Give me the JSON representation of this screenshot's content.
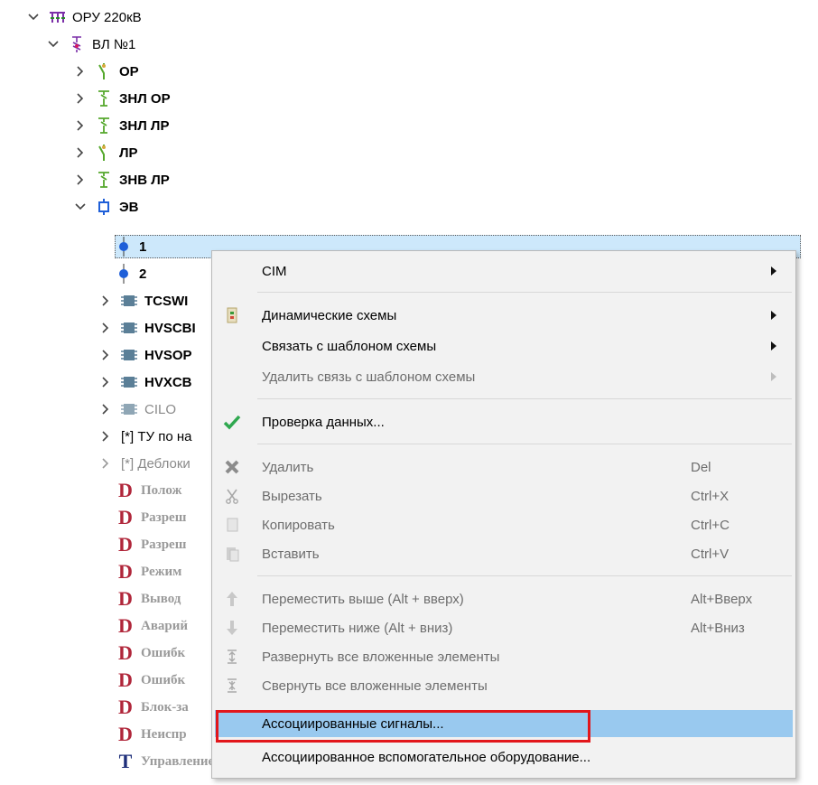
{
  "tree": {
    "root": "ОРУ 220кВ",
    "line": "ВЛ №1",
    "children": [
      "ОР",
      "ЗНЛ ОР",
      "ЗНЛ ЛР",
      "ЛР",
      "ЗНВ ЛР",
      "ЭВ"
    ],
    "ev_children": [
      "1",
      "2"
    ],
    "devices": [
      "TCSWI",
      "HVSCBI",
      "HVSOP",
      "HVXCB",
      "CILO"
    ],
    "groups": [
      "[*] ТУ по на",
      "[*] Деблоки"
    ],
    "d_items": [
      "Полож",
      "Разреш",
      "Разреш",
      "Режим",
      "Вывод",
      "Аварий",
      "Ошибк",
      "Ошибк",
      "Блок-за",
      "Неиспр"
    ],
    "t_item": "Управление",
    "colors": {
      "selection": "#cde8fb",
      "d_icon": "#b0263a",
      "t_icon": "#1e2f7a",
      "switch_green": "#55a82c",
      "ev_blue": "#1f5fd8"
    }
  },
  "menu": {
    "cim": "CIM",
    "dynamic": "Динамические схемы",
    "link_template": "Связать с шаблоном схемы",
    "unlink_template": "Удалить связь с шаблоном схемы",
    "check": "Проверка данных...",
    "delete": "Удалить",
    "delete_key": "Del",
    "cut": "Вырезать",
    "cut_key": "Ctrl+X",
    "copy": "Копировать",
    "copy_key": "Ctrl+C",
    "paste": "Вставить",
    "paste_key": "Ctrl+V",
    "move_up": "Переместить выше (Alt + вверх)",
    "move_up_key": "Alt+Вверх",
    "move_down": "Переместить ниже (Alt + вниз)",
    "move_down_key": "Alt+Вниз",
    "expand": "Развернуть все вложенные элементы",
    "collapse": "Свернуть все вложенные элементы",
    "assoc_signals": "Ассоциированные сигналы...",
    "assoc_equipment": "Ассоциированное вспомогательное оборудование...",
    "highlight_color": "#99c9ef",
    "annotation_color": "#e2161b"
  }
}
